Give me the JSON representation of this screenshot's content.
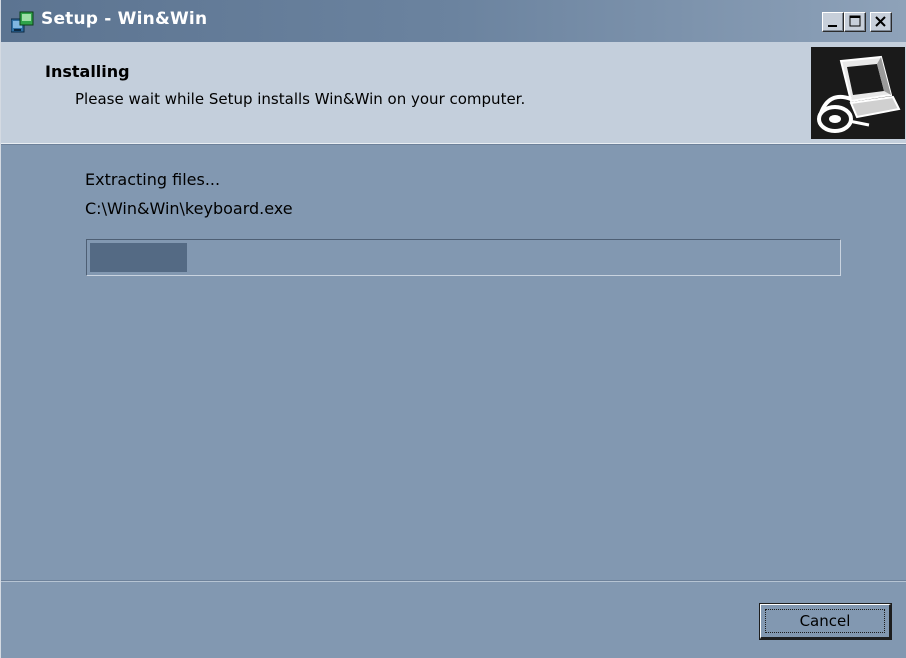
{
  "window": {
    "title": "Setup - Win&Win",
    "colors": {
      "titlebar_start": "#5c7491",
      "titlebar_end": "#8ea2b9",
      "header_bg": "#c4cfdc",
      "body_bg": "#8298b1",
      "progress_fill": "#546a84"
    }
  },
  "header": {
    "heading": "Installing",
    "subheading": "Please wait while Setup installs Win&Win on your computer."
  },
  "progress": {
    "status_label": "Extracting files...",
    "current_file": "C:\\Win&Win\\keyboard.exe",
    "percent": 13
  },
  "footer": {
    "cancel_label": "Cancel"
  },
  "icons": {
    "app_icon": "setup-app-icon",
    "wizard_image": "computer-install-icon",
    "minimize": "minimize-icon",
    "maximize": "maximize-icon",
    "close": "close-icon"
  }
}
